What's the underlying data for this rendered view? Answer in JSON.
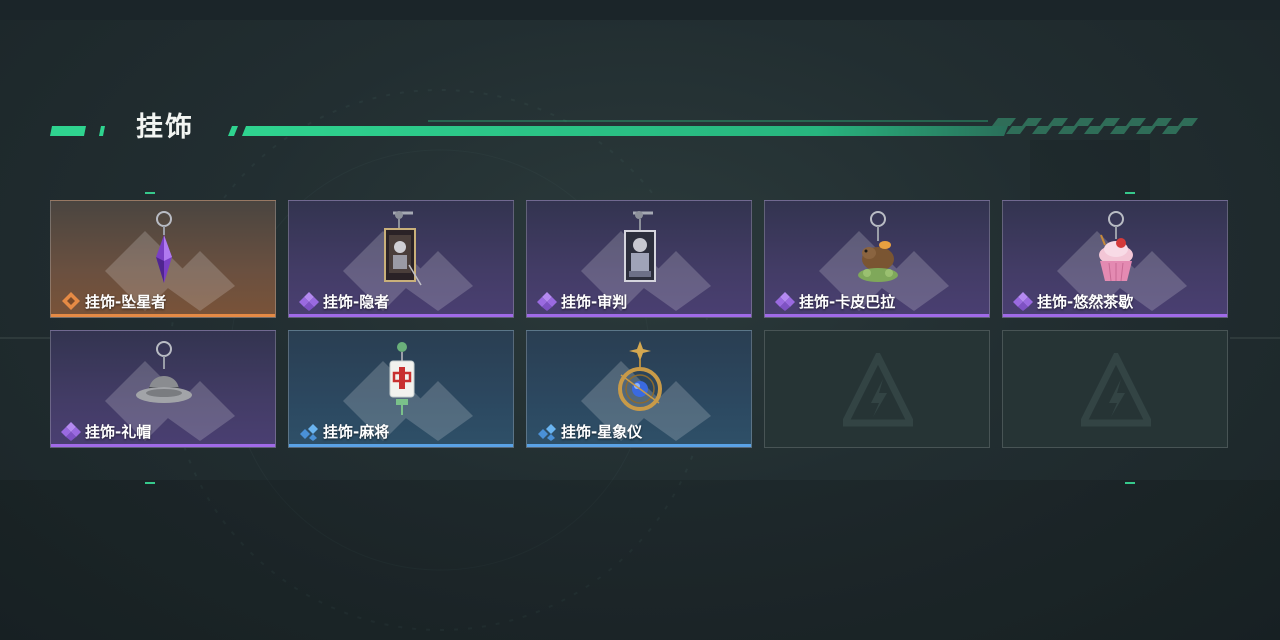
{
  "section": {
    "title": "挂饰",
    "accent_color": "#2fd38f"
  },
  "items": [
    {
      "label": "挂饰-坠星者",
      "rarity": "orange",
      "icon": "purple-crystal-charm-icon"
    },
    {
      "label": "挂饰-隐者",
      "rarity": "purple",
      "icon": "tarot-card-charm-icon"
    },
    {
      "label": "挂饰-审判",
      "rarity": "purple",
      "icon": "tarot-card-charm-icon"
    },
    {
      "label": "挂饰-卡皮巴拉",
      "rarity": "purple",
      "icon": "capybara-charm-icon"
    },
    {
      "label": "挂饰-悠然茶歇",
      "rarity": "purple",
      "icon": "cupcake-charm-icon"
    },
    {
      "label": "挂饰-礼帽",
      "rarity": "purple",
      "icon": "fedora-hat-charm-icon"
    },
    {
      "label": "挂饰-麻将",
      "rarity": "blue",
      "icon": "mahjong-tile-charm-icon"
    },
    {
      "label": "挂饰-星象仪",
      "rarity": "blue",
      "icon": "astrolabe-charm-icon"
    }
  ],
  "empty_slots": 2,
  "colors": {
    "orange": "#e58a45",
    "purple": "#a06ae8",
    "blue": "#5aa2e6"
  }
}
